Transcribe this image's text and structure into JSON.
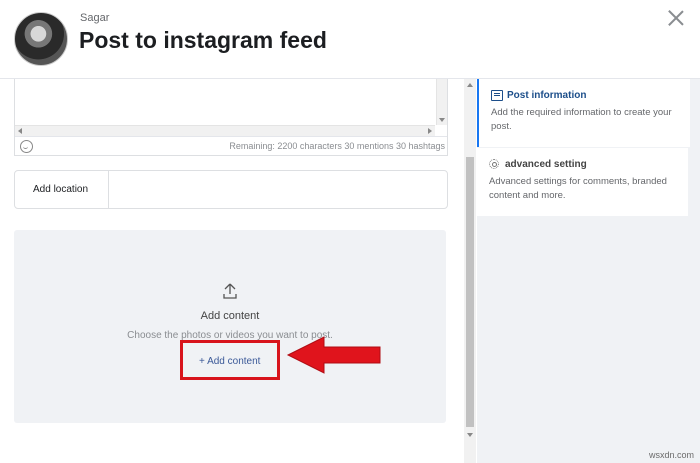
{
  "header": {
    "user_name": "Sagar",
    "title": "Post to instagram feed"
  },
  "caption": {
    "remaining_text": "Remaining: 2200 characters 30 mentions 30 hashtags"
  },
  "location": {
    "label": "Add location"
  },
  "dropzone": {
    "title": "Add content",
    "subtitle": "Choose the photos or videos you want to post.",
    "button_label": "+ Add content"
  },
  "sidebar": {
    "items": [
      {
        "title": "Post information",
        "desc": "Add the required information to create your post.",
        "icon": "document-icon"
      },
      {
        "title": "advanced setting",
        "desc": "Advanced settings for comments, branded content and more.",
        "icon": "gear-icon"
      }
    ]
  },
  "watermark": "wsxdn.com",
  "colors": {
    "highlight_border": "#d8141c",
    "arrow": "#e0141c",
    "active_accent": "#1877f2",
    "link": "#3b5998"
  }
}
